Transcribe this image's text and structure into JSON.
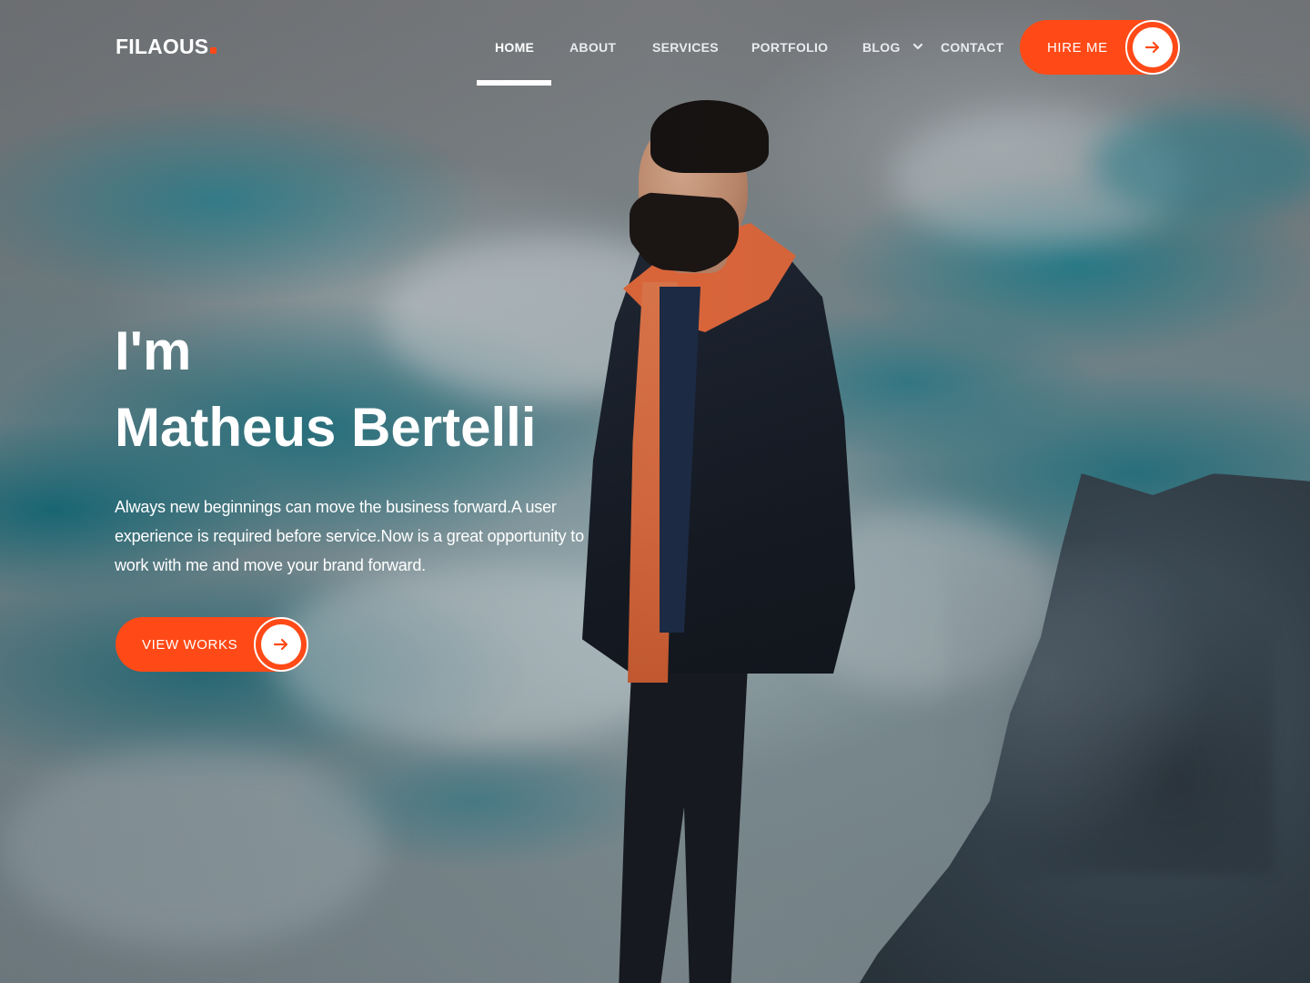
{
  "brand": {
    "logo_text": "FILAOUS",
    "accent_color": "#ff4a17"
  },
  "nav": {
    "items": [
      {
        "label": "HOME",
        "active": true
      },
      {
        "label": "ABOUT",
        "active": false
      },
      {
        "label": "SERVICES",
        "active": false
      },
      {
        "label": "PORTFOLIO",
        "active": false
      },
      {
        "label": "BLOG",
        "active": false,
        "has_dropdown": true,
        "icon": "chevron-down-icon"
      },
      {
        "label": "CONTACT",
        "active": false
      }
    ],
    "cta": {
      "label": "HIRE ME",
      "icon": "arrow-right-icon"
    }
  },
  "hero": {
    "greeting": "I'm",
    "name": "Matheus Bertelli",
    "description": "Always new beginnings can move the business forward.A user experience is required before service.Now is a great opportunity to work with me and move your brand forward.",
    "cta": {
      "label": "VIEW WORKS",
      "icon": "arrow-right-icon"
    }
  }
}
